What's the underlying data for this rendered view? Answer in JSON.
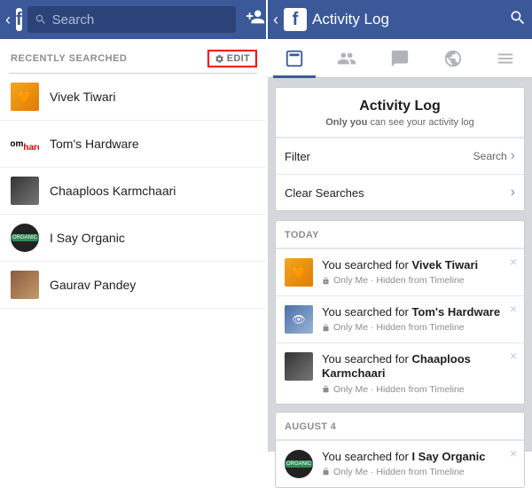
{
  "left": {
    "search_placeholder": "Search",
    "section_title": "RECENTLY SEARCHED",
    "edit_label": "EDIT",
    "items": [
      {
        "label": "Vivek Tiwari"
      },
      {
        "label": "Tom's Hardware"
      },
      {
        "label": "Chaaploos Karmchaari"
      },
      {
        "label": "I Say Organic"
      },
      {
        "label": "Gaurav Pandey"
      }
    ]
  },
  "right": {
    "header_title": "Activity Log",
    "card": {
      "title": "Activity Log",
      "sub_prefix": "Only you",
      "sub_rest": " can see your activity log",
      "filter_label": "Filter",
      "filter_value": "Search",
      "clear_label": "Clear Searches"
    },
    "groups": [
      {
        "title": "TODAY",
        "rows": [
          {
            "prefix": "You searched for ",
            "name": "Vivek Tiwari",
            "meta": "Only Me · Hidden from Timeline"
          },
          {
            "prefix": "You searched for ",
            "name": "Tom's Hardware",
            "meta": "Only Me · Hidden from Timeline"
          },
          {
            "prefix": "You searched for ",
            "name": "Chaaploos Karmchaari",
            "meta": "Only Me · Hidden from Timeline"
          }
        ]
      },
      {
        "title": "AUGUST 4",
        "rows": [
          {
            "prefix": "You searched for ",
            "name": "I Say Organic",
            "meta": "Only Me · Hidden from Timeline"
          }
        ]
      }
    ]
  }
}
